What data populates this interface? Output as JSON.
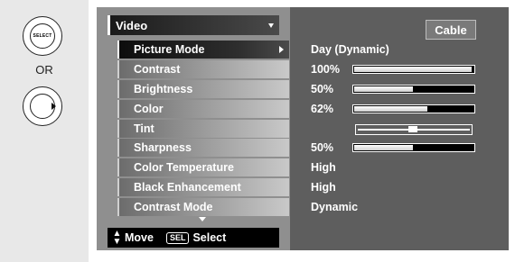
{
  "remote": {
    "select_label": "SELECT",
    "or_label": "OR",
    "right_arrow_icon": "right-arrow-icon"
  },
  "menu": {
    "title": "Video",
    "input_source": "Cable",
    "items": [
      {
        "label": "Picture Mode",
        "value": "Day (Dynamic)",
        "active": true
      },
      {
        "label": "Contrast",
        "value": "100%",
        "level": 1.0
      },
      {
        "label": "Brightness",
        "value": "50%",
        "level": 0.5
      },
      {
        "label": "Color",
        "value": "62%",
        "level": 0.62
      },
      {
        "label": "Tint",
        "value": "",
        "level": 0.5
      },
      {
        "label": "Sharpness",
        "value": "50%",
        "level": 0.5
      },
      {
        "label": "Color Temperature",
        "value": "High"
      },
      {
        "label": "Black Enhancement",
        "value": "High"
      },
      {
        "label": "Contrast Mode",
        "value": "Dynamic"
      }
    ]
  },
  "footer": {
    "move_label": "Move",
    "sel_key": "SEL",
    "select_label": "Select"
  }
}
